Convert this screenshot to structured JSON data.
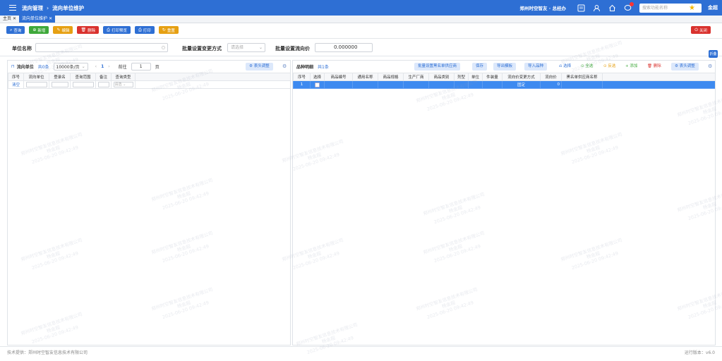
{
  "header": {
    "breadcrumb": [
      "流向管理",
      "流向单位维护"
    ],
    "company": "郑州时空智友 · 总经办",
    "search_placeholder": "搜索功能名称",
    "user": "金超"
  },
  "tabs": [
    {
      "label": "主页",
      "active": false
    },
    {
      "label": "流向单位维护",
      "active": true
    }
  ],
  "toolbar": {
    "query": "查询",
    "add": "新增",
    "edit": "编辑",
    "delete": "删除",
    "print_preview": "打印预览",
    "print": "打印",
    "reset": "重置",
    "close": "关闭"
  },
  "filter": {
    "unit_name_label": "单位名称",
    "batch_change_label": "批量设置变更方式",
    "batch_change_placeholder": "请选择",
    "batch_price_label": "批量设置流向价",
    "batch_price_value": "0.000000",
    "collapse": "折叠"
  },
  "left_panel": {
    "title": "流向单位",
    "count": "共0条",
    "page_size": "10000条/页",
    "page": "1",
    "goto_label": "前往",
    "goto_value": "1",
    "page_suffix": "页",
    "header_adjust": "表头调整",
    "columns": [
      "序号",
      "流向单位",
      "登录名",
      "查询范围",
      "备注",
      "查询类型"
    ],
    "filter_row": {
      "clear": "清空",
      "type_placeholder": "请选"
    }
  },
  "right_panel": {
    "title": "品种明细",
    "count": "共1条",
    "buttons": {
      "batch_whitelist": "批量设置黑名单供应商",
      "save": "保存",
      "export_template": "导出模板",
      "import": "导入品种",
      "select": "选择",
      "select_all": "全选",
      "invert": "反选",
      "add": "添加",
      "delete": "删除",
      "header_adjust": "表头调整"
    },
    "columns": [
      "序号",
      "选择",
      "商品编号",
      "通用名称",
      "商品规格",
      "生产厂商",
      "商品类别",
      "剂型",
      "单位",
      "件装量",
      "流向价变更方式",
      "流向价",
      "黑名单供应商名称"
    ],
    "rows": [
      {
        "idx": "1",
        "mode": "固定",
        "price": "0"
      }
    ]
  },
  "footer": {
    "left": "技术提供：郑州时空智友信息技术有限公司",
    "right": "运行版本：v6.0"
  },
  "watermark": {
    "line1": "郑州时空智友信息技术有限公司",
    "line2": "杨金超",
    "line3": "2025-06-20 09:42:49"
  },
  "colors": {
    "primary": "#2e6fd4",
    "success": "#3ea83a",
    "warning": "#e6a013",
    "danger": "#d9322e"
  }
}
